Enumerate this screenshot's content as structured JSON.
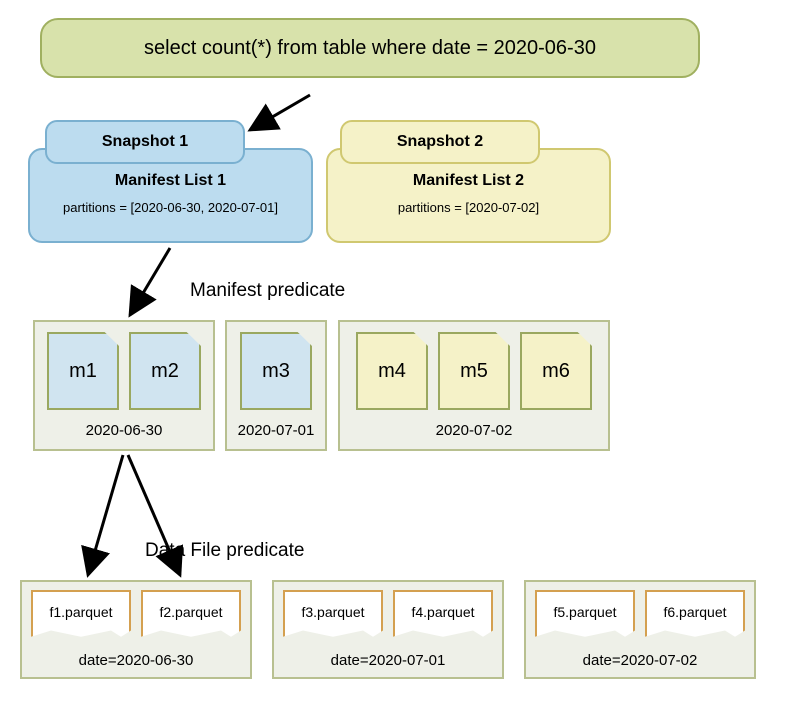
{
  "query": "select count(*) from table where date = 2020-06-30",
  "snapshots": {
    "s1": "Snapshot 1",
    "s2": "Snapshot 2"
  },
  "manifestLists": {
    "ml1": {
      "title": "Manifest List 1",
      "partitions": "partitions = [2020-06-30, 2020-07-01]"
    },
    "ml2": {
      "title": "Manifest List 2",
      "partitions": "partitions = [2020-07-02]"
    }
  },
  "labels": {
    "manifestPredicate": "Manifest predicate",
    "dataFilePredicate": "Data File predicate"
  },
  "manifestGroups": {
    "g1": {
      "files": [
        "m1",
        "m2"
      ],
      "date": "2020-06-30"
    },
    "g2": {
      "files": [
        "m3"
      ],
      "date": "2020-07-01"
    },
    "g3": {
      "files": [
        "m4",
        "m5",
        "m6"
      ],
      "date": "2020-07-02"
    }
  },
  "fileGroups": {
    "f1": {
      "files": [
        "f1.parquet",
        "f2.parquet"
      ],
      "date": "date=2020-06-30"
    },
    "f2": {
      "files": [
        "f3.parquet",
        "f4.parquet"
      ],
      "date": "date=2020-07-01"
    },
    "f3": {
      "files": [
        "f5.parquet",
        "f6.parquet"
      ],
      "date": "date=2020-07-02"
    }
  }
}
